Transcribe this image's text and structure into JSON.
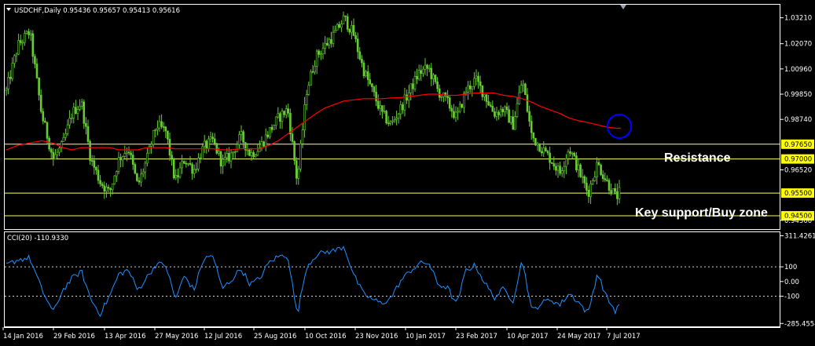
{
  "window": {
    "symbol_header": "USDCHF,Daily  0.95436 0.95657 0.95413 0.95616",
    "indicator_header": "CCI(20) -110.9330"
  },
  "colors": {
    "background": "#000000",
    "frame": "#ffffff",
    "candles": "#66cc33",
    "moving_average": "#ff0000",
    "level_lines": "#ffff66",
    "level_tag": "#ffff00",
    "cci_line": "#1e90ff",
    "cci_levels": "#cccccc",
    "circle": "#0000ff"
  },
  "annotations": {
    "resistance": "Resistance",
    "support": "Key support/Buy zone"
  },
  "chart_data": [
    {
      "type": "bar",
      "name": "price",
      "x_labels": [
        "14 Jan 2016",
        "29 Feb 2016",
        "13 Apr 2016",
        "27 May 2016",
        "12 Jul 2016",
        "25 Aug 2016",
        "10 Oct 2016",
        "23 Nov 2016",
        "10 Jan 2017",
        "23 Feb 2017",
        "10 Apr 2017",
        "24 May 2017",
        "7 Jul 2017"
      ],
      "y_ticks": [
        "1.03210",
        "1.02070",
        "1.00960",
        "0.99850",
        "0.98740",
        "0.96520",
        "0.94300"
      ],
      "ylim": [
        0.9395,
        1.0375
      ],
      "levels": [
        {
          "value": 0.9765,
          "label": "0.97650"
        },
        {
          "value": 0.97,
          "label": "0.97000"
        },
        {
          "value": 0.955,
          "label": "0.95500"
        },
        {
          "value": 0.945,
          "label": "0.94500"
        }
      ],
      "x": [
        0,
        5,
        10,
        15,
        20,
        24,
        28,
        32,
        36,
        40,
        44,
        48,
        52,
        56,
        60,
        64,
        68,
        72,
        76,
        80,
        84,
        88,
        92,
        96,
        100,
        104,
        108,
        112,
        116,
        120,
        124,
        128,
        132,
        136,
        140,
        144,
        148,
        152,
        156,
        160,
        164,
        168,
        172,
        176,
        180,
        184,
        188,
        192,
        196,
        200,
        204,
        208,
        212,
        216,
        220,
        224,
        228,
        232,
        236,
        240,
        244,
        248,
        252,
        256,
        260,
        262
      ],
      "close": [
        1.0,
        1.02,
        1.026,
        0.99,
        0.97,
        0.976,
        0.99,
        0.995,
        0.97,
        0.96,
        0.955,
        0.97,
        0.975,
        0.958,
        0.97,
        0.985,
        0.982,
        0.96,
        0.97,
        0.965,
        0.975,
        0.978,
        0.968,
        0.972,
        0.98,
        0.972,
        0.975,
        0.982,
        0.988,
        0.992,
        0.96,
        1.0,
        1.015,
        1.02,
        1.025,
        1.032,
        1.025,
        1.01,
        1.0,
        0.99,
        0.985,
        0.992,
        1.0,
        1.008,
        1.01,
        1.0,
        0.995,
        0.988,
        1.0,
        1.005,
        0.998,
        0.99,
        0.992,
        0.985,
        1.005,
        0.98,
        0.975,
        0.97,
        0.964,
        0.975,
        0.965,
        0.955,
        0.968,
        0.96,
        0.953,
        0.9562
      ],
      "ma": [
        0.974,
        0.976,
        0.977,
        0.978,
        0.977,
        0.975,
        0.974,
        0.975,
        0.975,
        0.975,
        0.975,
        0.974,
        0.974,
        0.974,
        0.975,
        0.975,
        0.975,
        0.9745,
        0.9745,
        0.9745,
        0.9745,
        0.9745,
        0.974,
        0.974,
        0.9745,
        0.9745,
        0.9745,
        0.976,
        0.978,
        0.981,
        0.984,
        0.987,
        0.99,
        0.9925,
        0.994,
        0.9955,
        0.996,
        0.9965,
        0.9965,
        0.9965,
        0.9968,
        0.997,
        0.9975,
        0.998,
        0.9985,
        0.9985,
        0.998,
        0.998,
        0.9985,
        0.999,
        0.999,
        0.999,
        0.998,
        0.9975,
        0.9965,
        0.995,
        0.993,
        0.9915,
        0.99,
        0.988,
        0.9868,
        0.986,
        0.985,
        0.984,
        0.9835,
        0.9835
      ]
    },
    {
      "type": "line",
      "name": "CCI(20)",
      "y_ticks": [
        "311.4261",
        "100",
        "0.00",
        "-100",
        "-285.4554"
      ],
      "ylim": [
        -300,
        330
      ],
      "levels": [
        100,
        -100
      ],
      "x": [
        0,
        5,
        10,
        15,
        20,
        24,
        28,
        32,
        36,
        40,
        44,
        48,
        52,
        56,
        60,
        64,
        68,
        72,
        76,
        80,
        84,
        88,
        92,
        96,
        100,
        104,
        108,
        112,
        116,
        120,
        124,
        128,
        132,
        136,
        140,
        144,
        148,
        152,
        156,
        160,
        164,
        168,
        172,
        176,
        180,
        184,
        188,
        192,
        196,
        200,
        204,
        208,
        212,
        216,
        220,
        224,
        228,
        232,
        236,
        240,
        244,
        248,
        252,
        256,
        260,
        262
      ],
      "values": [
        110,
        150,
        160,
        -50,
        -210,
        -60,
        20,
        70,
        -120,
        -220,
        -100,
        50,
        80,
        -60,
        30,
        120,
        110,
        -120,
        40,
        -60,
        150,
        180,
        -50,
        10,
        90,
        -20,
        20,
        130,
        170,
        180,
        -230,
        100,
        180,
        200,
        210,
        240,
        50,
        -80,
        -120,
        -150,
        -110,
        0,
        70,
        120,
        130,
        -20,
        -40,
        -160,
        80,
        110,
        -10,
        -110,
        -50,
        -130,
        150,
        -200,
        -150,
        -120,
        -160,
        -80,
        -140,
        -220,
        60,
        -110,
        -210,
        -111
      ]
    }
  ]
}
